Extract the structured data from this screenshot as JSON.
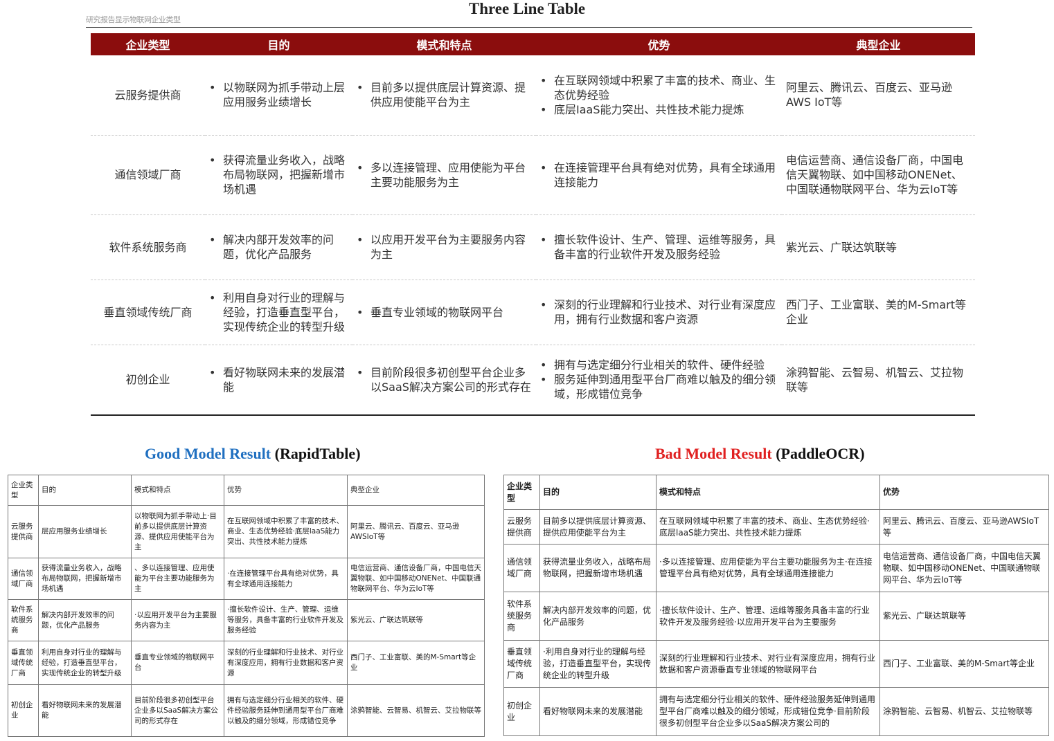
{
  "main_title": "Three Line Table",
  "source_caption": "研究报告显示物联网企业类型",
  "source_table": {
    "headers": [
      "企业类型",
      "目的",
      "模式和特点",
      "优势",
      "典型企业"
    ],
    "rows": [
      {
        "type": "云服务提供商",
        "purpose": [
          "以物联网为抓手带动上层应用服务业绩增长"
        ],
        "mode": [
          "目前多以提供底层计算资源、提供应用使能平台为主"
        ],
        "advantage": [
          "在互联网领域中积累了丰富的技术、商业、生态优势经验",
          "底层IaaS能力突出、共性技术能力提炼"
        ],
        "companies": "阿里云、腾讯云、百度云、亚马逊AWS IoT等"
      },
      {
        "type": "通信领域厂商",
        "purpose": [
          "获得流量业务收入，战略布局物联网，把握新增市场机遇"
        ],
        "mode": [
          "多以连接管理、应用使能为平台主要功能服务为主"
        ],
        "advantage": [
          "在连接管理平台具有绝对优势，具有全球通用连接能力"
        ],
        "companies": "电信运营商、通信设备厂商，中国电信天翼物联、如中国移动ONENet、中国联通物联网平台、华为云IoT等"
      },
      {
        "type": "软件系统服务商",
        "purpose": [
          "解决内部开发效率的问题，优化产品服务"
        ],
        "mode": [
          "以应用开发平台为主要服务内容为主"
        ],
        "advantage": [
          "擅长软件设计、生产、管理、运维等服务，具备丰富的行业软件开发及服务经验"
        ],
        "companies": "紫光云、广联达筑联等"
      },
      {
        "type": "垂直领域传统厂商",
        "purpose": [
          "利用自身对行业的理解与经验，打造垂直型平台，实现传统企业的转型升级"
        ],
        "mode": [
          "垂直专业领域的物联网平台"
        ],
        "advantage": [
          "深刻的行业理解和行业技术、对行业有深度应用，拥有行业数据和客户资源"
        ],
        "companies": "西门子、工业富联、美的M-Smart等企业"
      },
      {
        "type": "初创企业",
        "purpose": [
          "看好物联网未来的发展潜能"
        ],
        "mode": [
          "目前阶段很多初创型平台企业多以SaaS解决方案公司的形式存在"
        ],
        "advantage": [
          "拥有与选定细分行业相关的软件、硬件经验",
          "服务延伸到通用型平台厂商难以触及的细分领域，形成错位竞争"
        ],
        "companies": "涂鸦智能、云智易、机智云、艾拉物联等"
      }
    ]
  },
  "good_result": {
    "label": "Good Model Result",
    "model": "(RapidTable)",
    "color": "#1f6fc0",
    "rows": [
      [
        "企业类型",
        "目的",
        "模式和特点",
        "优势",
        "典型企业"
      ],
      [
        "云服务提供商",
        "层应用服务业绩增长",
        "以物联网为抓手带动上·目前多以提供底层计算资源、提供应用使能平台为主",
        "在互联网领域中积累了丰富的技术、商业、生态优势经验·底层laaS能力突出、共性技术能力提炼",
        "阿里云、腾讯云、百度云、亚马逊AWSIoT等"
      ],
      [
        "通信领域厂商",
        "获得流量业务收入，战略布局物联网，把握新增市场机遇",
        "、多以连接管理、应用使能为平台主要功能服务为主",
        "·在连接管理平台具有绝对优势，具有全球通用连接能力",
        "电信运营商、通信设备厂商，中国电信天翼物联、如中国移动ONENet、中国联通物联网平台、华为云IoT等"
      ],
      [
        "软件系统服务商",
        "解决内部开发效率的问题，优化产品服务",
        "·以应用开发平台为主要服务内容为主",
        "·擅长软件设计、生产、管理、运维等服务，具备丰富的行业软件开发及服务经验",
        "紫光云、广联达筑联等"
      ],
      [
        "垂直领域传统厂商",
        "利用自身对行业的理解与经验，打造垂直型平台，实现传统企业的转型升级",
        "垂直专业领域的物联网平台",
        "深刻的行业理解和行业技术、对行业有深度应用，拥有行业数据和客户资源",
        "西门子、工业富联、美的M-Smart等企业"
      ],
      [
        "初创企业",
        "看好物联网未来的发展潜能",
        "目前阶段很多初创型平台企业多以SaaS解决方案公司的形式存在",
        "拥有与选定细分行业相关的软件、硬件经验服务延伸到通用型平台厂商难以触及的细分领域，形成错位竞争",
        "涂鸦智能、云智易、机智云、艾拉物联等"
      ]
    ]
  },
  "bad_result": {
    "label": "Bad Model Result",
    "model": "(PaddleOCR)",
    "color": "#e02020",
    "rows": [
      [
        "企业类型",
        "目的",
        "模式和特点",
        "优势"
      ],
      [
        "云服务提供商",
        "目前多以提供底层计算资源、提供应用使能平台为主",
        "在互联网领域中积累了丰富的技术、商业、生态优势经验·底层laaS能力突出、共性技术能力提炼",
        "阿里云、腾讯云、百度云、亚马逊AWSIoT等"
      ],
      [
        "通信领域厂商",
        "获得流量业务收入，战略布局物联网，把握新增市场机遇",
        "·多以连接管理、应用使能为平台主要功能服务为主·在连接管理平台具有绝对优势，具有全球通用连接能力",
        "电信运营商、通信设备厂商，中国电信天翼物联、如中国移动ONENet、中国联通物联网平台、华为云IoT等"
      ],
      [
        "软件系统服务商",
        "解决内部开发效率的问题，优化产品服务",
        "·擅长软件设计、生产、管理、运维等服务具备丰富的行业软件开发及服务经验·以应用开发平台为主要服务",
        "紫光云、广联达筑联等"
      ],
      [
        "垂直领域传统厂商",
        "·利用自身对行业的理解与经验，打造垂直型平台，实现传统企业的转型升级",
        "深刻的行业理解和行业技术、对行业有深度应用，拥有行业数据和客户资源垂直专业领域的物联网平台",
        "西门子、工业富联、美的M-Smart等企业"
      ],
      [
        "初创企业",
        "看好物联网未来的发展潜能",
        "拥有与选定细分行业相关的软件、硬件经验服务延伸到通用型平台厂商难以触及的细分领域，形成错位竞争·目前阶段很多初创型平台企业多以SaaS解决方案公司的",
        "涂鸦智能、云智易、机智云、艾拉物联等"
      ]
    ]
  }
}
